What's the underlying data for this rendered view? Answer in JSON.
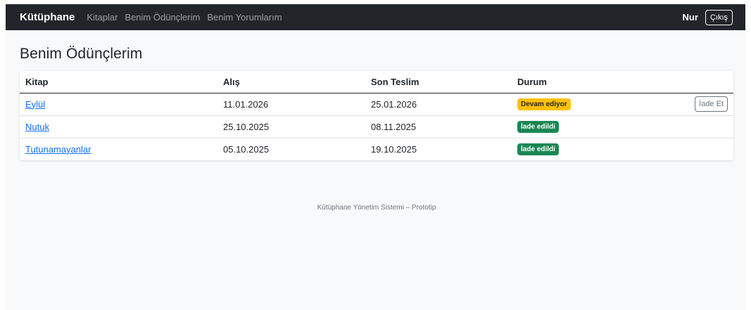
{
  "navbar": {
    "brand": "Kütüphane",
    "links": [
      "Kitaplar",
      "Benim Ödünçlerim",
      "Benim Yorumlarım"
    ],
    "user": "Nur",
    "logout_label": "Çıkış"
  },
  "main": {
    "title": "Benim Ödünçlerim",
    "table": {
      "headers": [
        "Kitap",
        "Alış",
        "Son Teslim",
        "Durum"
      ],
      "rows": [
        {
          "book": "Eylül",
          "taken": "11.01.2026",
          "due": "25.01.2026",
          "status": "Devam ediyor",
          "action": "İade Et"
        },
        {
          "book": "Nutuk",
          "taken": "25.10.2025",
          "due": "08.11.2025",
          "status": "İade edildi"
        },
        {
          "book": "Tutunamayanlar",
          "taken": "05.10.2025",
          "due": "19.10.2025",
          "status": "İade edildi"
        }
      ]
    }
  },
  "footer": "Kütüphane Yönetim Sistemi – Prototip",
  "colors": {
    "navbar_bg": "#212529",
    "link": "#0d6efd",
    "warning": "#ffc107",
    "success": "#198754"
  }
}
